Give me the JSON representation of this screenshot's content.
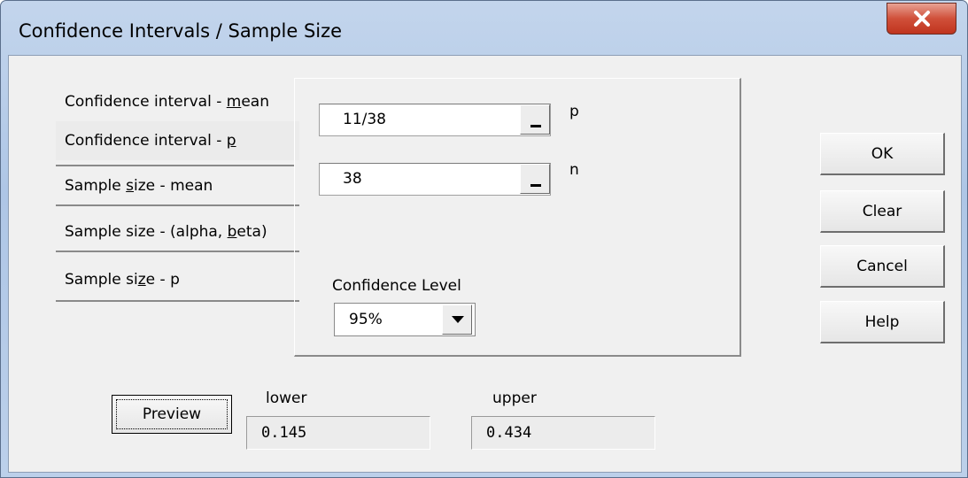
{
  "window": {
    "title": "Confidence Intervals / Sample Size",
    "close_glyph": "X"
  },
  "tabs": [
    {
      "label": "Confidence interval - mean",
      "active": false
    },
    {
      "label": "Confidence interval - p",
      "active": true
    },
    {
      "label": "Sample size - mean",
      "active": false
    },
    {
      "label": "Sample size - (alpha, beta)",
      "active": false
    },
    {
      "label": "Sample size - p",
      "active": false
    }
  ],
  "inputs": {
    "p": {
      "value": "11/38",
      "label": "p"
    },
    "n": {
      "value": "38",
      "label": "n"
    }
  },
  "confidence": {
    "label": "Confidence Level",
    "selected": "95%"
  },
  "buttons": {
    "ok": "OK",
    "clear": "Clear",
    "cancel": "Cancel",
    "help": "Help",
    "preview": "Preview"
  },
  "results": {
    "lower_label": "lower",
    "lower_value": "0.145",
    "upper_label": "upper",
    "upper_value": "0.434"
  },
  "icons": {
    "close": "close-icon",
    "refedit": "collapse-dialog-icon",
    "dropdown": "chevron-down-icon"
  }
}
